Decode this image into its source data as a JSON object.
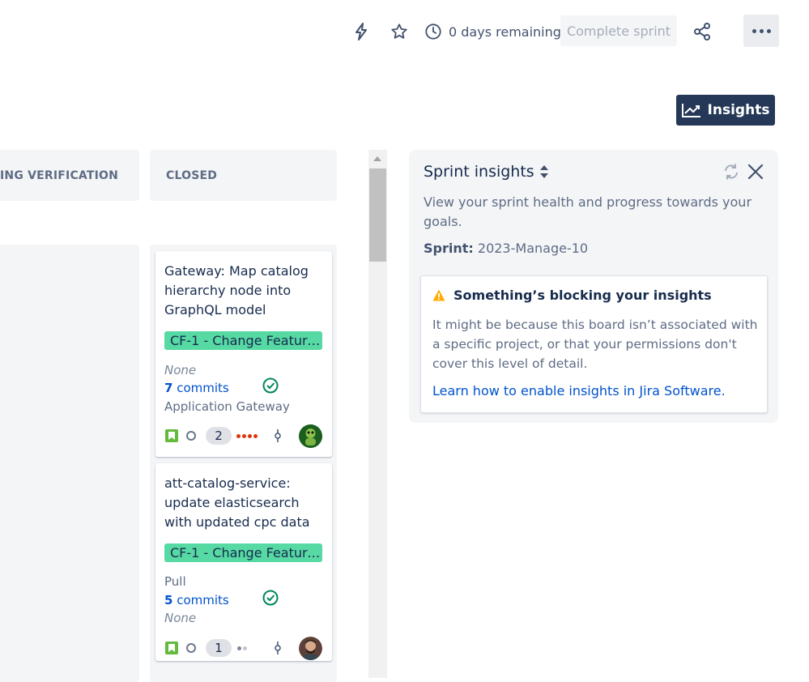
{
  "toolbar": {
    "days_remaining": "0 days remaining",
    "complete_sprint": "Complete sprint",
    "insights_label": "Insights"
  },
  "columns": [
    {
      "title": "ING VERIFICATION"
    },
    {
      "title": "CLOSED"
    }
  ],
  "cards": [
    {
      "title": "Gateway: Map catalog hierarchy node into GraphQL model",
      "epic": "CF-1 - Change Feature...",
      "line1": "None",
      "commits_count": "7",
      "commits_label": "commits",
      "line3": "Application Gateway",
      "estimate": "2",
      "priority": "highest"
    },
    {
      "title": "att-catalog-service: update elasticsearch with updated cpc data",
      "epic": "CF-1 - Change Feature...",
      "line1": "Pull",
      "commits_count": "5",
      "commits_label": "commits",
      "line3": "None",
      "estimate": "1",
      "priority": "low"
    }
  ],
  "insights_panel": {
    "title": "Sprint insights",
    "description": "View your sprint health and progress towards your goals.",
    "sprint_label": "Sprint:",
    "sprint_value": "2023-Manage-10",
    "warning_title": "Something’s blocking your insights",
    "warning_body": "It might be because this board isn’t associated with a specific project, or that your permissions don't cover this level of detail.",
    "warning_link": "Learn how to enable insights in Jira Software."
  },
  "colors": {
    "epic": "#57d9a3",
    "primary_button": "#253858",
    "link": "#0052cc",
    "story": "#63ba3c",
    "priority_high": "#de350b",
    "done": "#00875a"
  }
}
